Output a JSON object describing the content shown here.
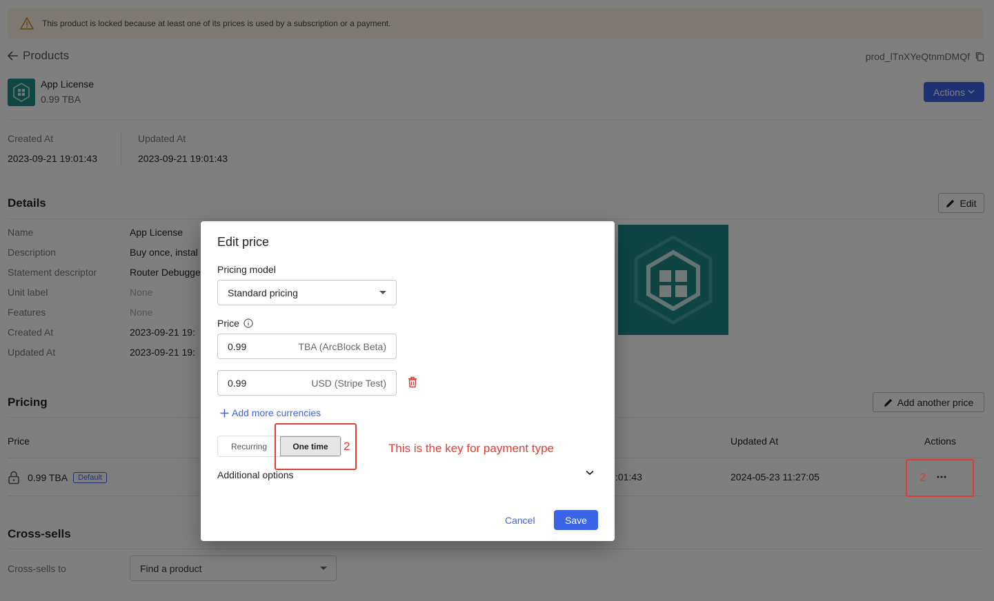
{
  "alert": {
    "message": "This product is locked because at least one of its prices is used by a subscription or a payment."
  },
  "header": {
    "back_label": "Products",
    "product_id": "prod_lTnXYeQtnmDMQf",
    "product_name": "App License",
    "product_price": "0.99 TBA",
    "actions_label": "Actions"
  },
  "meta": {
    "created_label": "Created At",
    "created_value": "2023-09-21 19:01:43",
    "updated_label": "Updated At",
    "updated_value": "2023-09-21 19:01:43"
  },
  "details": {
    "title": "Details",
    "edit_label": "Edit",
    "rows": [
      {
        "label": "Name",
        "value": "App License"
      },
      {
        "label": "Description",
        "value": "Buy once, instal"
      },
      {
        "label": "Statement descriptor",
        "value": "Router Debugge"
      },
      {
        "label": "Unit label",
        "value": "None"
      },
      {
        "label": "Features",
        "value": "None"
      },
      {
        "label": "Created At",
        "value": "2023-09-21 19:"
      },
      {
        "label": "Updated At",
        "value": "2023-09-21 19:"
      }
    ]
  },
  "pricing": {
    "title": "Pricing",
    "add_price_label": "Add another price",
    "col_price": "Price",
    "col_updated": "Updated At",
    "col_actions": "Actions",
    "row": {
      "price": "0.99 TBA",
      "badge": "Default",
      "created_partial": ":01:43",
      "updated": "2024-05-23 11:27:05"
    }
  },
  "crosssells": {
    "title": "Cross-sells",
    "label": "Cross-sells to",
    "select_value": "Find a product"
  },
  "modal": {
    "title": "Edit price",
    "pricing_model_label": "Pricing model",
    "pricing_model_value": "Standard pricing",
    "price_label": "Price",
    "prices": [
      {
        "amount": "0.99",
        "currency": "TBA (ArcBlock Beta)"
      },
      {
        "amount": "0.99",
        "currency": "USD (Stripe Test)"
      }
    ],
    "add_currencies_label": "Add more currencies",
    "toggle_recurring": "Recurring",
    "toggle_one_time": "One time",
    "additional_options_label": "Additional options",
    "cancel_label": "Cancel",
    "save_label": "Save"
  },
  "annotations": {
    "marker_one": "2",
    "marker_two": "2",
    "note": "This is the key for payment type"
  },
  "colors": {
    "accent": "#3b63e6",
    "annotation": "#e23b30",
    "brand_teal": "#1f8f8a",
    "alert_bg": "#fdf5e6"
  }
}
